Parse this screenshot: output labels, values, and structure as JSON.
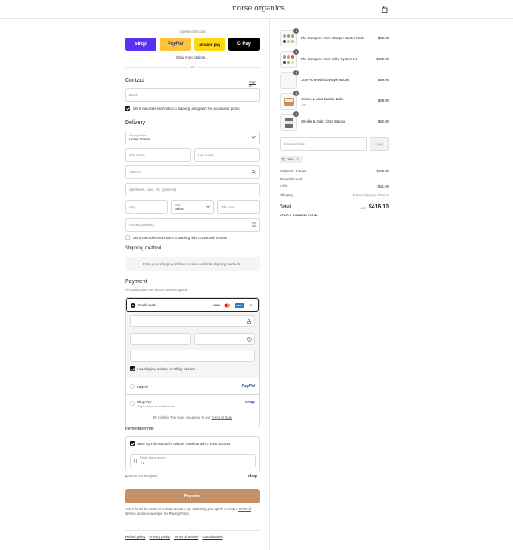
{
  "header": {
    "logo": "norse organics",
    "bag_icon": "shopping-bag-icon"
  },
  "express": {
    "title": "Express checkout",
    "shop_label": "shop",
    "paypal_label": "PayPal",
    "amazon_label": "amazon pay",
    "gpay_label": "G Pay",
    "more_options": "Show more options ⌄",
    "or": "OR"
  },
  "contact": {
    "title": "Contact",
    "sign_in": "Sign in",
    "email_placeholder": "Email",
    "email_opt_in": "Send me order information & tracking along with the occasional promo"
  },
  "delivery": {
    "title": "Delivery",
    "country_label": "Country/Region",
    "country_value": "United States",
    "first_name": "First name",
    "last_name": "Last name",
    "address": "Address",
    "apartment": "Apartment, suite, etc. (optional)",
    "city": "City",
    "state_label": "State",
    "state_value": "Select",
    "zip": "ZIP code",
    "phone": "Phone (optional)",
    "sms_opt_in": "Send me order information & tracking with occasional promos"
  },
  "shipping": {
    "title": "Shipping method",
    "note": "Enter your shipping address to view available shipping methods."
  },
  "payment": {
    "title": "Payment",
    "secure_note": "All transactions are secure and encrypted.",
    "credit_card_label": "Credit card",
    "brands": [
      "VISA",
      "MC",
      "AMEX"
    ],
    "more_brands": "+3",
    "billing_same": "Use shipping address as billing address",
    "paypal_option": "PayPal",
    "paypal_logo": "PayPal",
    "shoppay_option": "Shop Pay",
    "shoppay_sub": "Pay in full or in installments",
    "shoppay_logo": "shop"
  },
  "terms": {
    "prefix": "By clicking 'Pay now', you agree to our ",
    "link": "Terms of Sale"
  },
  "remember": {
    "title": "Remember me",
    "save_info": "Save my information for a faster checkout with a Shop account",
    "phone_label": "Mobile phone number",
    "phone_value": "+1",
    "secure_saved": "Secure and encrypted",
    "shop_logo": "shop"
  },
  "pay_now": "Pay now",
  "info": {
    "text1": "Your info will be saved to a Shop account. By continuing, you agree to Shop's ",
    "terms_link": "Terms of Service",
    "text2": " and acknowledge the ",
    "privacy_link": "Privacy Policy",
    "text3": "."
  },
  "footer": {
    "links": [
      "Refund policy",
      "Privacy policy",
      "Terms of service",
      "Cancellations"
    ]
  },
  "cart": {
    "items": [
      {
        "qty": "1",
        "name": "The Complete Acne Stopper Starter Pack",
        "sub": "",
        "price": "$69.00"
      },
      {
        "qty": "1",
        "name": "The Complete Acne Killer System 2.0",
        "sub": "",
        "price": "$159.00"
      },
      {
        "qty": "1",
        "name": "Cure Acne With Lifestyle eBook",
        "sub": "",
        "price": "$59.00"
      },
      {
        "qty": "1",
        "name": "Muscle & Joint Builder Balm",
        "sub": "1 oz",
        "price": "$49.00"
      },
      {
        "qty": "1",
        "name": "Wrinkle & Dark Circle Warrior",
        "sub": "",
        "price": "$82.00"
      }
    ],
    "discount_placeholder": "Discount code",
    "apply": "Apply",
    "code": "JAN",
    "subtotal_label": "Subtotal · 5 items",
    "subtotal_value": "$458.00",
    "order_discount_label": "Order discount",
    "discount_code": "JAN",
    "discount_value": "−$21.90",
    "shipping_label": "Shipping",
    "shipping_value": "Enter shipping address",
    "total_label": "Total",
    "currency": "USD",
    "total_value": "$416.10",
    "savings_label": "TOTAL SAVINGS",
    "savings_value": "$21.90"
  }
}
